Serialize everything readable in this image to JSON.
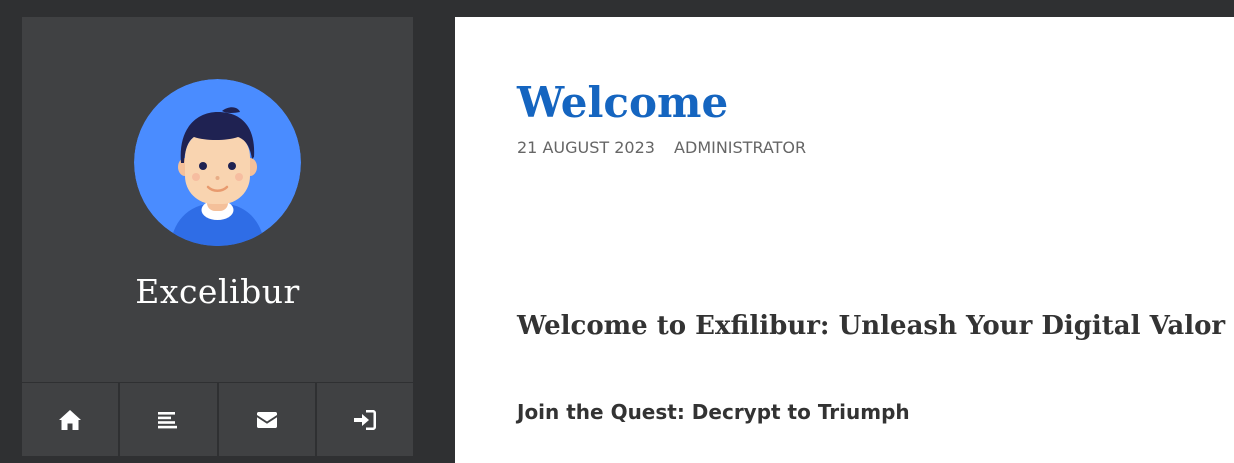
{
  "sidebar": {
    "site_title": "Excelibur",
    "avatar_icon": "user-avatar-icon",
    "nav": [
      {
        "icon": "home-icon"
      },
      {
        "icon": "align-left-icon"
      },
      {
        "icon": "envelope-icon"
      },
      {
        "icon": "sign-in-icon"
      }
    ]
  },
  "post": {
    "title": "Welcome",
    "date": "21 AUGUST 2023",
    "author": "ADMINISTRATOR",
    "heading": "Welcome to Exfilibur: Unleash Your Digital Valor",
    "subheading": "Join the Quest: Decrypt to Triumph"
  },
  "colors": {
    "background": "#2f3032",
    "sidebar": "#404143",
    "title_accent": "#1565c0",
    "avatar_circle": "#4a8cff"
  }
}
